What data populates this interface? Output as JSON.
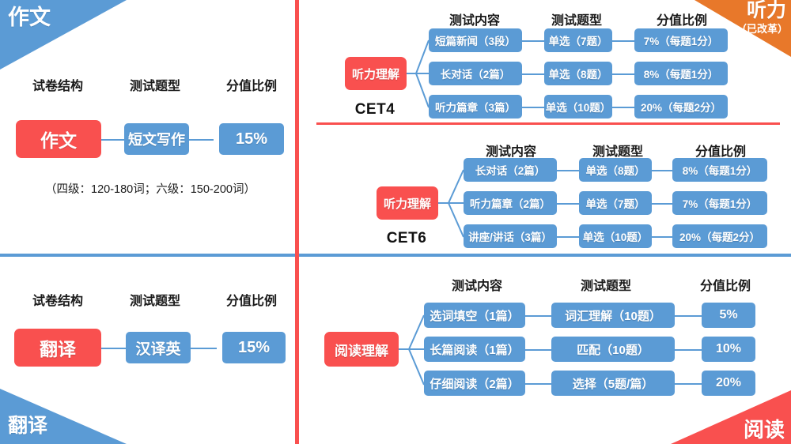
{
  "corners": {
    "top_left": {
      "label": "作文",
      "color": "#5b9bd5"
    },
    "bottom_left": {
      "label": "翻译",
      "color": "#5b9bd5"
    },
    "top_right": {
      "label": "听力",
      "sub_label": "（已改革）",
      "color": "#e8782a"
    },
    "bottom_right": {
      "label": "阅读",
      "color": "#f9504f"
    }
  },
  "colors": {
    "red": "#f9504f",
    "blue": "#5b9bd5",
    "orange": "#e8782a",
    "connector": "#5b9bd5",
    "text_dark": "#1a1a1a"
  },
  "writing": {
    "headers": {
      "structure": "试卷结构",
      "question_type": "测试题型",
      "score_ratio": "分值比例"
    },
    "root": "作文",
    "type": "短文写作",
    "ratio": "15%",
    "note": "（四级：120-180词；六级：150-200词）"
  },
  "translation": {
    "headers": {
      "structure": "试卷结构",
      "question_type": "测试题型",
      "score_ratio": "分值比例"
    },
    "root": "翻译",
    "type": "汉译英",
    "ratio": "15%"
  },
  "listening_cet4": {
    "exam_label": "CET4",
    "root": "听力理解",
    "headers": {
      "content": "测试内容",
      "question_type": "测试题型",
      "score_ratio": "分值比例"
    },
    "rows": [
      {
        "content": "短篇新闻（3段）",
        "type": "单选（7题）",
        "ratio": "7%（每题1分）"
      },
      {
        "content": "长对话（2篇）",
        "type": "单选（8题）",
        "ratio": "8%（每题1分）"
      },
      {
        "content": "听力篇章（3篇）",
        "type": "单选（10题）",
        "ratio": "20%（每题2分）"
      }
    ]
  },
  "listening_cet6": {
    "exam_label": "CET6",
    "root": "听力理解",
    "headers": {
      "content": "测试内容",
      "question_type": "测试题型",
      "score_ratio": "分值比例"
    },
    "rows": [
      {
        "content": "长对话（2篇）",
        "type": "单选（8题）",
        "ratio": "8%（每题1分）"
      },
      {
        "content": "听力篇章（2篇）",
        "type": "单选（7题）",
        "ratio": "7%（每题1分）"
      },
      {
        "content": "讲座/讲话（3篇）",
        "type": "单选（10题）",
        "ratio": "20%（每题2分）"
      }
    ]
  },
  "reading": {
    "root": "阅读理解",
    "headers": {
      "content": "测试内容",
      "question_type": "测试题型",
      "score_ratio": "分值比例"
    },
    "rows": [
      {
        "content": "选词填空（1篇）",
        "type": "词汇理解（10题）",
        "ratio": "5%"
      },
      {
        "content": "长篇阅读（1篇）",
        "type": "匹配（10题）",
        "ratio": "10%"
      },
      {
        "content": "仔细阅读（2篇）",
        "type": "选择（5题/篇）",
        "ratio": "20%"
      }
    ]
  }
}
